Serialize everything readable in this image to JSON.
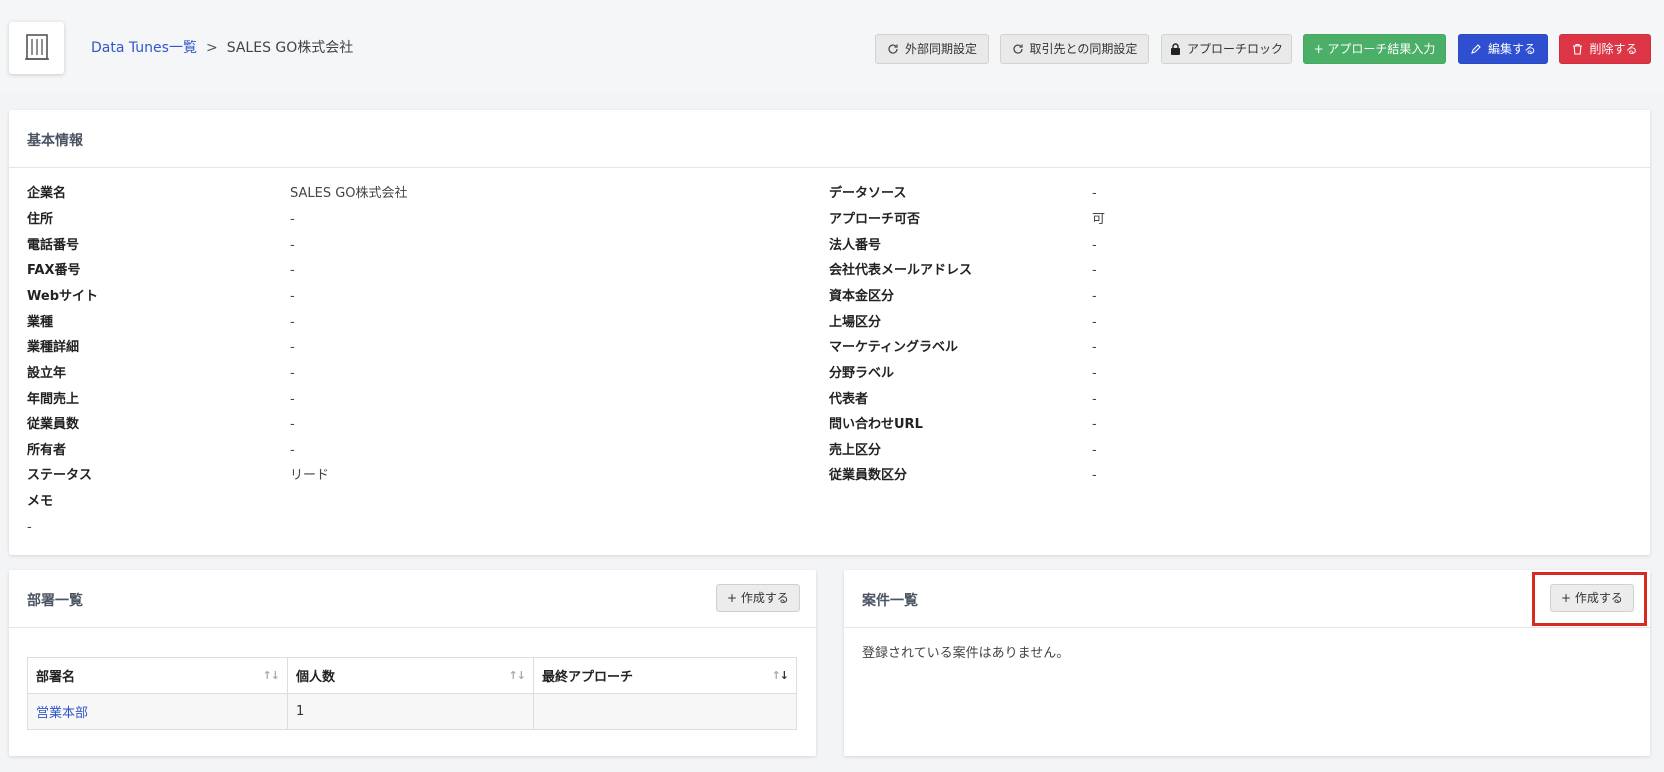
{
  "header": {
    "logo_icon": "building-icon",
    "breadcrumb_parent": "Data Tunes一覧",
    "breadcrumb_separator": ">",
    "breadcrumb_current": "SALES GO株式会社",
    "buttons": {
      "external_sync": "外部同期設定",
      "client_sync": "取引先との同期設定",
      "approach_lock": "アプローチロック",
      "approach_result": "+ アプローチ結果入力",
      "edit": "編集する",
      "delete": "削除する"
    }
  },
  "basic_info": {
    "title": "基本情報",
    "left": [
      {
        "label": "企業名",
        "value": "SALES GO株式会社"
      },
      {
        "label": "住所",
        "value": "-"
      },
      {
        "label": "電話番号",
        "value": "-"
      },
      {
        "label": "FAX番号",
        "value": "-"
      },
      {
        "label": "Webサイト",
        "value": "-"
      },
      {
        "label": "業種",
        "value": "-"
      },
      {
        "label": "業種詳細",
        "value": "-"
      },
      {
        "label": "設立年",
        "value": "-"
      },
      {
        "label": "年間売上",
        "value": "-"
      },
      {
        "label": "従業員数",
        "value": "-"
      },
      {
        "label": "所有者",
        "value": "-"
      },
      {
        "label": "ステータス",
        "value": "リード"
      }
    ],
    "memo_label": "メモ",
    "memo_value": "-",
    "right": [
      {
        "label": "データソース",
        "value": "-"
      },
      {
        "label": "アプローチ可否",
        "value": "可"
      },
      {
        "label": "法人番号",
        "value": "-"
      },
      {
        "label": "会社代表メールアドレス",
        "value": "-"
      },
      {
        "label": "資本金区分",
        "value": "-"
      },
      {
        "label": "上場区分",
        "value": "-"
      },
      {
        "label": "マーケティングラベル",
        "value": "-"
      },
      {
        "label": "分野ラベル",
        "value": "-"
      },
      {
        "label": "代表者",
        "value": "-"
      },
      {
        "label": "問い合わせURL",
        "value": "-"
      },
      {
        "label": "売上区分",
        "value": "-"
      },
      {
        "label": "従業員数区分",
        "value": "-"
      }
    ]
  },
  "departments": {
    "title": "部署一覧",
    "create_label": "+ 作成する",
    "columns": [
      "部署名",
      "個人数",
      "最終アプローチ"
    ],
    "rows": [
      {
        "name": "営業本部",
        "count": "1",
        "last_approach": ""
      }
    ]
  },
  "projects": {
    "title": "案件一覧",
    "create_label": "+ 作成する",
    "empty_message": "登録されている案件はありません。"
  },
  "colors": {
    "green": "#4caf68",
    "blue": "#2d4fd0",
    "red": "#dc3545",
    "link": "#3157c9",
    "highlight": "#d72a22"
  }
}
